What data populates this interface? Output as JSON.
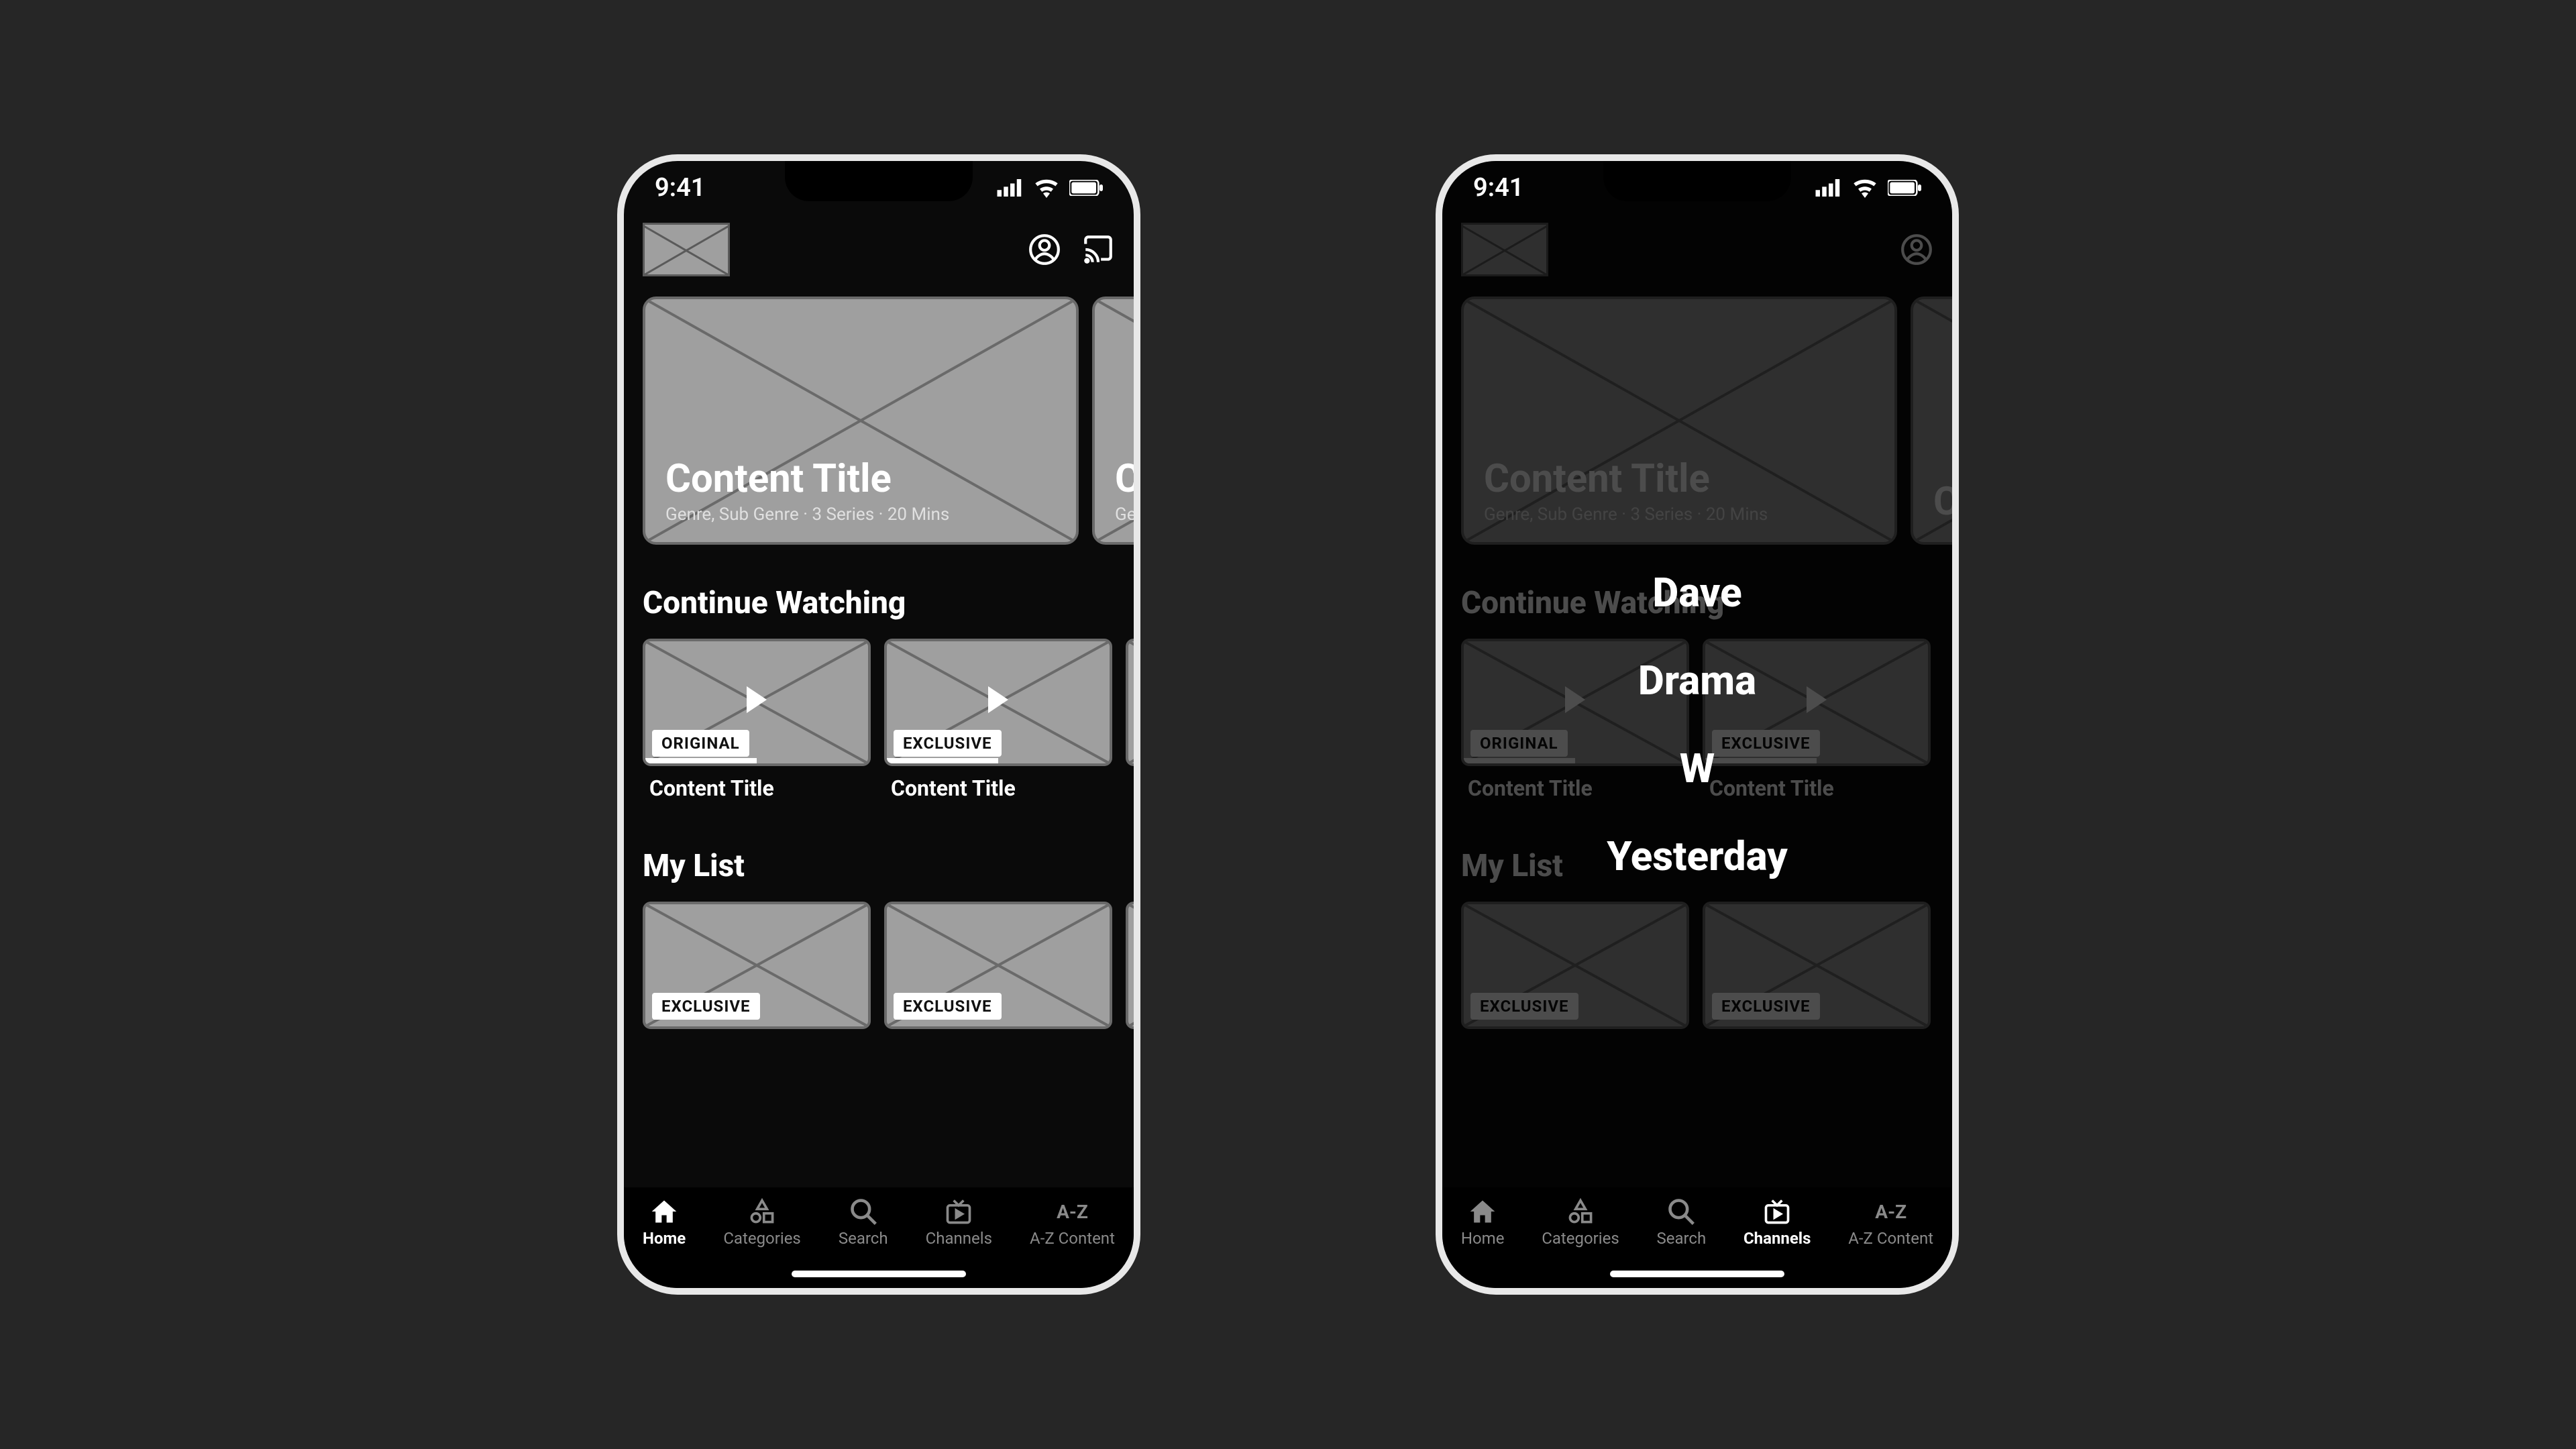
{
  "status": {
    "time": "9:41"
  },
  "hero": {
    "cards": [
      {
        "title": "Content Title",
        "meta": "Genre, Sub Genre · 3 Series · 20 Mins"
      },
      {
        "title": "Co",
        "meta": "Ge"
      }
    ]
  },
  "sections": {
    "continue": {
      "title": "Continue Watching",
      "cards": [
        {
          "badge": "ORIGINAL",
          "title": "Content Title"
        },
        {
          "badge": "EXCLUSIVE",
          "title": "Content Title"
        }
      ]
    },
    "mylist": {
      "title": "My List",
      "cards": [
        {
          "badge": "EXCLUSIVE"
        },
        {
          "badge": "EXCLUSIVE"
        }
      ]
    }
  },
  "nav": {
    "home": "Home",
    "categories": "Categories",
    "search": "Search",
    "channels": "Channels",
    "az": "A-Z Content",
    "az_icon": "A-Z"
  },
  "channels_overlay": [
    "Dave",
    "Drama",
    "W",
    "Yesterday"
  ]
}
